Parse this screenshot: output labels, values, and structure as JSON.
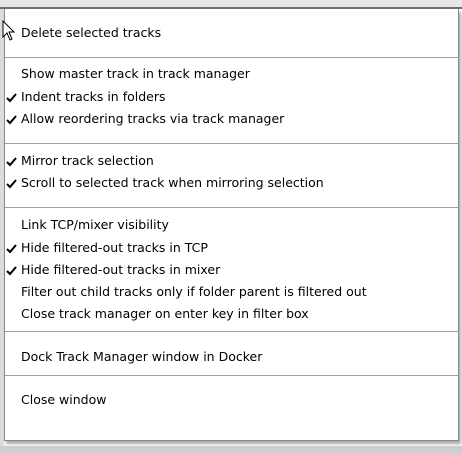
{
  "menu": {
    "groups": [
      {
        "items": [
          {
            "label": "Delete selected tracks",
            "checked": false
          }
        ]
      },
      {
        "items": [
          {
            "label": "Show master track in track manager",
            "checked": false
          },
          {
            "label": "Indent tracks in folders",
            "checked": true
          },
          {
            "label": "Allow reordering tracks via track manager",
            "checked": true
          }
        ]
      },
      {
        "items": [
          {
            "label": "Mirror track selection",
            "checked": true
          },
          {
            "label": "Scroll to selected track when mirroring selection",
            "checked": true
          }
        ]
      },
      {
        "items": [
          {
            "label": "Link TCP/mixer visibility",
            "checked": false
          },
          {
            "label": "Hide filtered-out tracks in TCP",
            "checked": true
          },
          {
            "label": "Hide filtered-out tracks in mixer",
            "checked": true
          },
          {
            "label": "Filter out child tracks only if folder parent is filtered out",
            "checked": false
          },
          {
            "label": "Close track manager on enter key in filter box",
            "checked": false
          }
        ]
      },
      {
        "items": [
          {
            "label": "Dock Track Manager window in Docker",
            "checked": false
          }
        ]
      },
      {
        "items": [
          {
            "label": "Close window",
            "checked": false
          }
        ]
      }
    ]
  },
  "icons": {
    "cursor": "arrow-pointer-icon",
    "check": "checkmark-icon"
  },
  "colors": {
    "menu_background": "#ffffff",
    "menu_border": "#8a8a8a",
    "separator": "#a0a0a0",
    "text": "#000000"
  }
}
